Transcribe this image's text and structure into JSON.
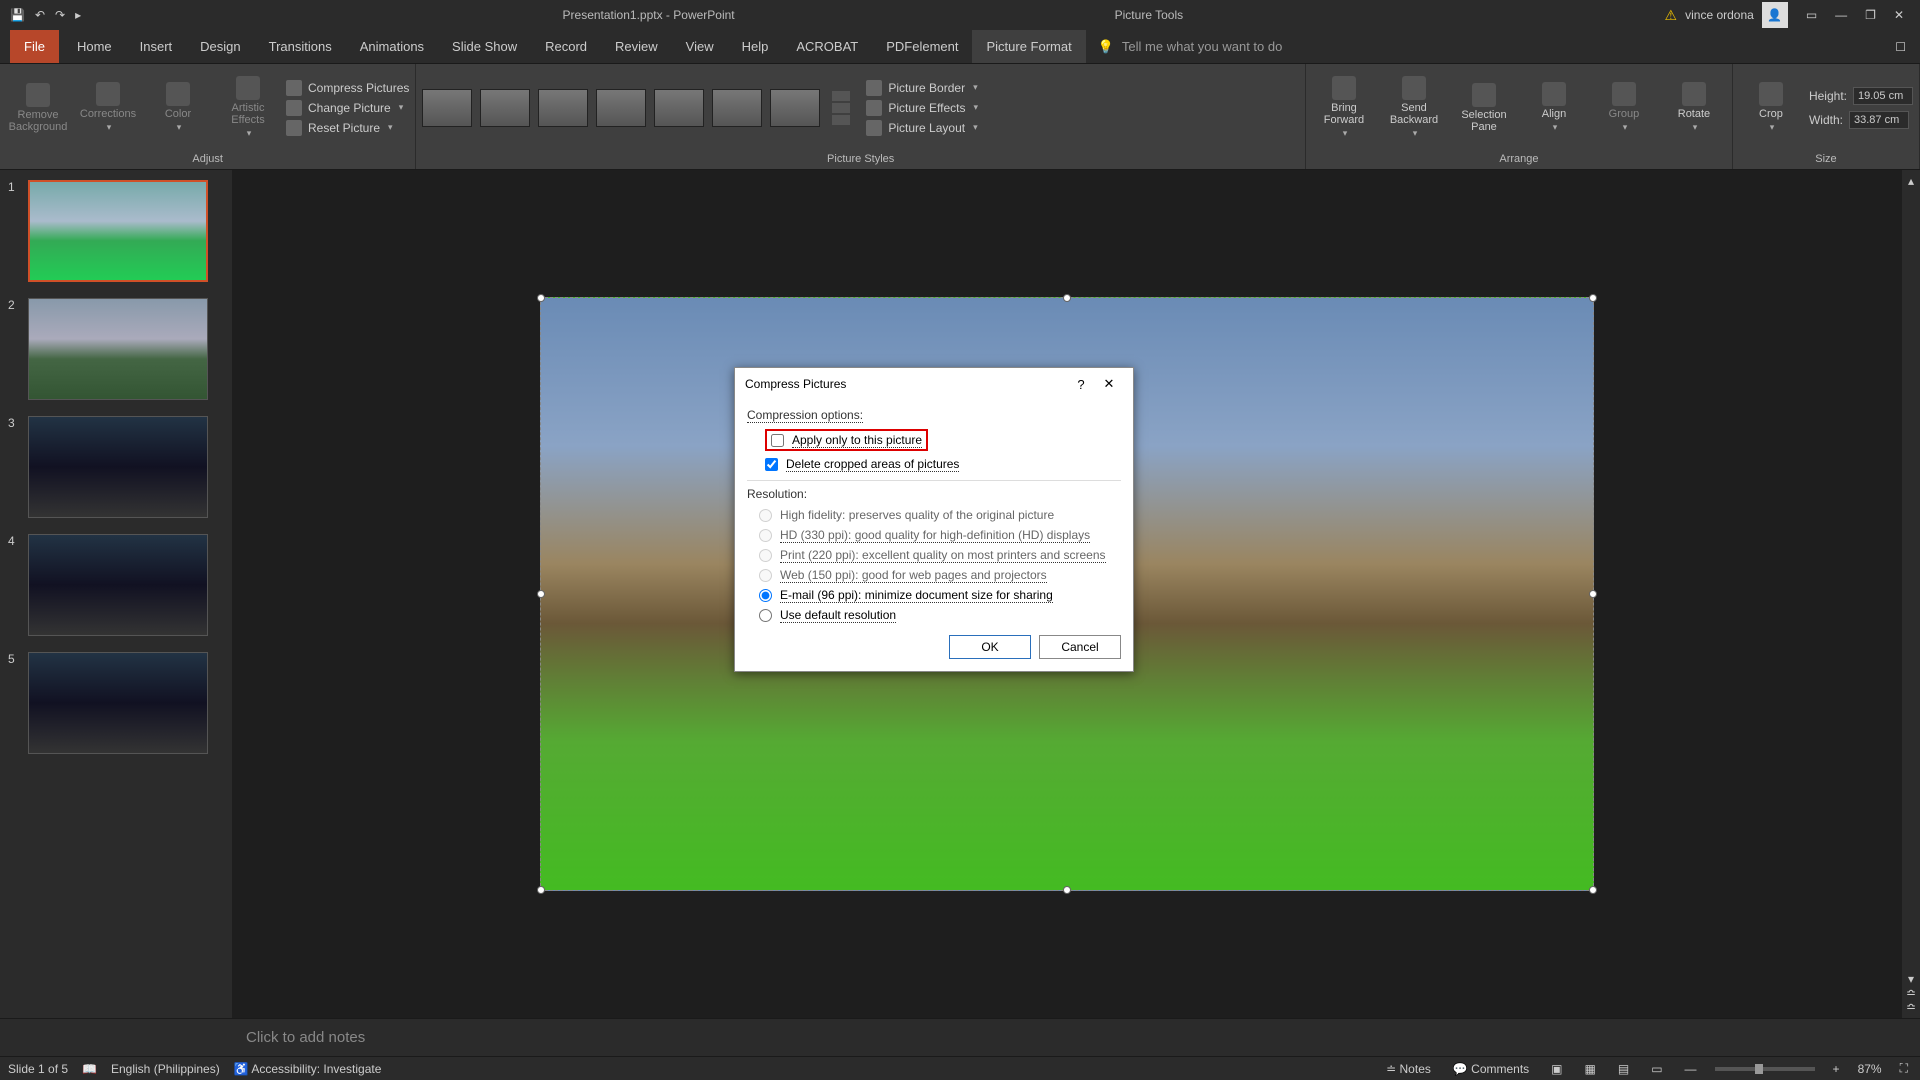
{
  "titlebar": {
    "doc_title": "Presentation1.pptx  -  PowerPoint",
    "context_tab": "Picture Tools",
    "user_name": "vince ordona"
  },
  "ribbon_tabs": {
    "file": "File",
    "home": "Home",
    "insert": "Insert",
    "design": "Design",
    "transitions": "Transitions",
    "animations": "Animations",
    "slideshow": "Slide Show",
    "record": "Record",
    "review": "Review",
    "view": "View",
    "help": "Help",
    "acrobat": "ACROBAT",
    "pdfelement": "PDFelement",
    "picture_format": "Picture Format",
    "tell_me": "Tell me what you want to do"
  },
  "ribbon": {
    "adjust": {
      "remove_bg": "Remove Background",
      "corrections": "Corrections",
      "color": "Color",
      "artistic": "Artistic Effects",
      "compress": "Compress Pictures",
      "change": "Change Picture",
      "reset": "Reset Picture",
      "label": "Adjust"
    },
    "styles": {
      "border": "Picture Border",
      "effects": "Picture Effects",
      "layout": "Picture Layout",
      "label": "Picture Styles"
    },
    "arrange": {
      "bring_fwd": "Bring Forward",
      "send_back": "Send Backward",
      "selection": "Selection Pane",
      "align": "Align",
      "group": "Group",
      "rotate": "Rotate",
      "label": "Arrange"
    },
    "size": {
      "crop": "Crop",
      "height_label": "Height:",
      "height_val": "19.05 cm",
      "width_label": "Width:",
      "width_val": "33.87 cm",
      "label": "Size"
    }
  },
  "slides": [
    {
      "num": "1",
      "cls": "sky1"
    },
    {
      "num": "2",
      "cls": "sky2"
    },
    {
      "num": "3",
      "cls": "dark"
    },
    {
      "num": "4",
      "cls": "dark"
    },
    {
      "num": "5",
      "cls": "dark"
    }
  ],
  "dialog": {
    "title": "Compress Pictures",
    "compression_label": "Compression options:",
    "apply_only": "Apply only to this picture",
    "delete_cropped": "Delete cropped areas of pictures",
    "resolution_label": "Resolution:",
    "res_highfidelity": "High fidelity: preserves quality of the original picture",
    "res_hd": "HD (330 ppi): good quality for high-definition (HD) displays",
    "res_print": "Print (220 ppi): excellent quality on most printers and screens",
    "res_web": "Web (150 ppi): good for web pages and projectors",
    "res_email": "E-mail (96 ppi): minimize document size for sharing",
    "res_default": "Use default resolution",
    "ok": "OK",
    "cancel": "Cancel"
  },
  "notes": {
    "placeholder": "Click to add notes"
  },
  "status": {
    "slide_count": "Slide 1 of 5",
    "language": "English (Philippines)",
    "accessibility": "Accessibility: Investigate",
    "notes_btn": "Notes",
    "comments_btn": "Comments",
    "zoom": "87%"
  }
}
